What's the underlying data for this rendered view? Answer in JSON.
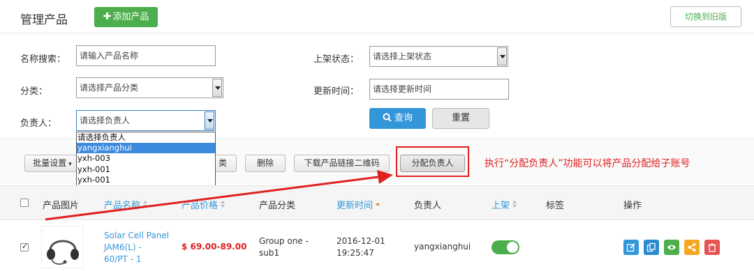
{
  "header": {
    "title": "管理产品",
    "add_label": "添加产品",
    "old_version_label": "切换到旧版"
  },
  "filters": {
    "name_label": "名称搜索：",
    "name_placeholder": "请输入产品名称",
    "category_label": "分类：",
    "category_value": "请选择产品分类",
    "owner_label": "负责人：",
    "owner_value": "请选择负责人",
    "status_label": "上架状态：",
    "status_value": "请选择上架状态",
    "update_label": "更新时间：",
    "update_placeholder": "请选择更新时间",
    "search_label": "查询",
    "reset_label": "重置"
  },
  "owner_dropdown": {
    "options": [
      "请选择负责人",
      "yangxianghui",
      "yxh-003",
      "yxh-001",
      "yxh-001"
    ],
    "selected_index": 1
  },
  "toolbar": {
    "bulk_label": "批量设置",
    "category_tail": "类",
    "delete_label": "删除",
    "qr_label": "下载产品链接二维码",
    "assign_label": "分配负责人"
  },
  "annotation": "执行“分配负责人”功能可以将产品分配给子账号",
  "table": {
    "headers": {
      "image": "产品图片",
      "name": "产品名称",
      "price": "产品价格",
      "category": "产品分类",
      "updated": "更新时间",
      "owner": "负责人",
      "listed": "上架",
      "tags": "标签",
      "actions": "操作"
    },
    "rows": [
      {
        "checked": true,
        "name_lines": [
          "Solar Cell Panel",
          "JAM6(L) -",
          "60/PT - 1"
        ],
        "price": "$ 69.00-89.00",
        "category_lines": [
          "Group one -",
          "sub1"
        ],
        "updated_lines": [
          "2016-12-01",
          "19:25:47"
        ],
        "owner": "yangxianghui",
        "listed": true
      }
    ]
  },
  "colors": {
    "green": "#4cae4c",
    "blue": "#3396d9",
    "red_annotation": "#e02020",
    "action_edit": "#3396d9",
    "action_copy": "#2a8bd3",
    "action_view": "#4cae4c",
    "action_share": "#f5a623",
    "action_delete": "#e55353"
  },
  "icons": {
    "search": "search-icon",
    "plus": "plus-icon",
    "actions": [
      "edit-icon",
      "copy-icon",
      "eye-icon",
      "share-icon",
      "trash-icon"
    ]
  }
}
